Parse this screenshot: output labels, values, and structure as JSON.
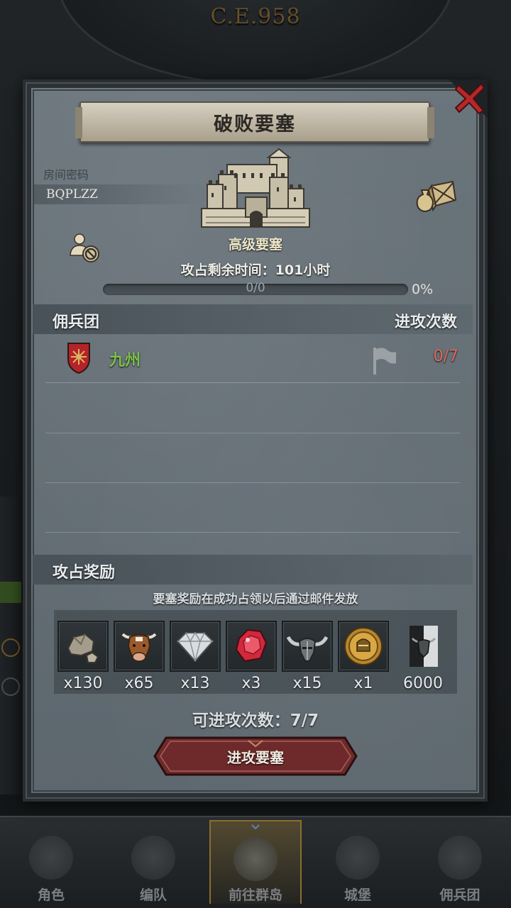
{
  "background": {
    "year": "C.E.958"
  },
  "modal": {
    "title": "破败要塞",
    "room_code_label": "房间密码",
    "room_code": "BQPLZZ",
    "fortress_name": "高级要塞",
    "time_remaining": "攻占剩余时间：101小时",
    "progress": {
      "value": 0,
      "text": "0/0",
      "percent": "0%"
    },
    "mercenary_section": {
      "title": "佣兵团",
      "attacks_header": "进攻次数",
      "rows": [
        {
          "name": "九州",
          "attacks": "0/7"
        }
      ]
    },
    "rewards": {
      "title": "攻占奖励",
      "note": "要塞奖励在成功占领以后通过邮件发放",
      "items": [
        {
          "icon": "stone-icon",
          "qty": "x130"
        },
        {
          "icon": "cattle-icon",
          "qty": "x65"
        },
        {
          "icon": "diamond-icon",
          "qty": "x13"
        },
        {
          "icon": "ruby-icon",
          "qty": "x3"
        },
        {
          "icon": "horned-helmet-icon",
          "qty": "x15"
        },
        {
          "icon": "gold-medal-icon",
          "qty": "x1"
        },
        {
          "icon": "bull-banner-icon",
          "qty": "6000"
        }
      ]
    },
    "attack_count": "可进攻次数：7/7",
    "attack_button": "进攻要塞"
  },
  "bottom_nav": {
    "items": [
      {
        "label": "角色",
        "icon": "knight-icon"
      },
      {
        "label": "编队",
        "icon": "formation-icon"
      },
      {
        "label": "前往群岛",
        "icon": "islands-icon",
        "active": true
      },
      {
        "label": "城堡",
        "icon": "castle-icon"
      },
      {
        "label": "佣兵团",
        "icon": "mercenary-icon"
      }
    ]
  },
  "colors": {
    "accent_green": "#7ec24d",
    "attack_count_red": "#e06a5c",
    "button_red": "#6e2a2a",
    "year_gold": "#b98d4e"
  }
}
